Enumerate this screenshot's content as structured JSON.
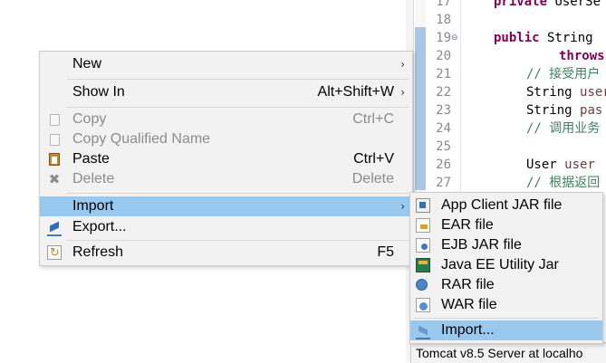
{
  "editor": {
    "line_numbers": [
      "17",
      "18",
      "19",
      "20",
      "21",
      "22",
      "23",
      "24",
      "25",
      "26",
      "27"
    ],
    "lines": {
      "l17_kw": "private",
      "l17_rest": " UserSe",
      "l19_kw": "public",
      "l19_rest": " String ",
      "l20": "throws",
      "l21": "// 接受用户",
      "l22_type": "String ",
      "l22_var": "user",
      "l23_type": "String ",
      "l23_var": "pas",
      "l24": "// 调用业务",
      "l26_type": "User ",
      "l26_var": "user",
      "l27": "// 根据返回"
    },
    "fold_marker": "⊖"
  },
  "status_bar": {
    "text": "Tomcat v8.5 Server at localho"
  },
  "context_menu": {
    "items": [
      {
        "label": "New",
        "shortcut": "",
        "submenu": true,
        "enabled": true
      },
      {
        "label": "Show In",
        "shortcut": "Alt+Shift+W",
        "submenu": true,
        "enabled": true
      },
      {
        "label": "Copy",
        "shortcut": "Ctrl+C",
        "submenu": false,
        "enabled": false
      },
      {
        "label": "Copy Qualified Name",
        "shortcut": "",
        "submenu": false,
        "enabled": false
      },
      {
        "label": "Paste",
        "shortcut": "Ctrl+V",
        "submenu": false,
        "enabled": true
      },
      {
        "label": "Delete",
        "shortcut": "Delete",
        "submenu": false,
        "enabled": false
      },
      {
        "label": "Import",
        "shortcut": "",
        "submenu": true,
        "enabled": true,
        "selected": true
      },
      {
        "label": "Export...",
        "shortcut": "",
        "submenu": false,
        "enabled": true
      },
      {
        "label": "Refresh",
        "shortcut": "F5",
        "submenu": false,
        "enabled": true
      }
    ],
    "submenu_arrow": "›"
  },
  "import_submenu": {
    "items": [
      {
        "label": "App Client JAR file",
        "icon": "app-client-jar-icon"
      },
      {
        "label": "EAR file",
        "icon": "ear-file-icon"
      },
      {
        "label": "EJB JAR file",
        "icon": "ejb-jar-icon"
      },
      {
        "label": "Java EE Utility Jar",
        "icon": "utility-jar-icon"
      },
      {
        "label": "RAR file",
        "icon": "rar-file-icon"
      },
      {
        "label": "WAR file",
        "icon": "war-file-icon"
      },
      {
        "label": "Import...",
        "icon": "import-wizard-icon",
        "selected": true
      }
    ]
  },
  "colors": {
    "menu_bg": "#f2f2f2",
    "selection": "#99c9ef",
    "disabled_text": "#8c8c8c",
    "keyword": "#7f0055",
    "comment": "#3f7f5f"
  }
}
